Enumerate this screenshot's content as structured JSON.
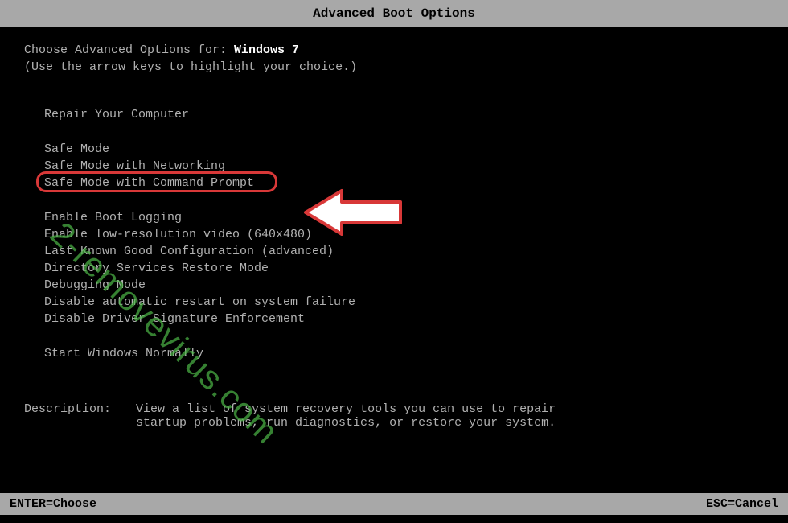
{
  "title": "Advanced Boot Options",
  "header": {
    "prefix": "Choose Advanced Options for: ",
    "os": "Windows 7",
    "instruction": "(Use the arrow keys to highlight your choice.)"
  },
  "groups": [
    {
      "items": [
        "Repair Your Computer"
      ]
    },
    {
      "items": [
        "Safe Mode",
        "Safe Mode with Networking",
        "Safe Mode with Command Prompt"
      ]
    },
    {
      "items": [
        "Enable Boot Logging",
        "Enable low-resolution video (640x480)",
        "Last Known Good Configuration (advanced)",
        "Directory Services Restore Mode",
        "Debugging Mode",
        "Disable automatic restart on system failure",
        "Disable Driver Signature Enforcement"
      ]
    },
    {
      "items": [
        "Start Windows Normally"
      ]
    }
  ],
  "highlighted_item": "Safe Mode with Command Prompt",
  "description": {
    "label": "Description:",
    "text": "View a list of system recovery tools you can use to repair startup problems, run diagnostics, or restore your system."
  },
  "status": {
    "left": "ENTER=Choose",
    "right": "ESC=Cancel"
  },
  "watermark": "2-removevirus.com"
}
